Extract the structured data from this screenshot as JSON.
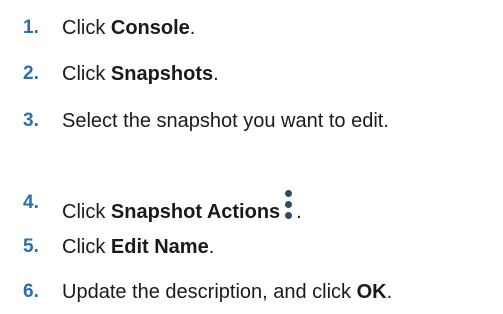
{
  "steps": [
    {
      "number": "1.",
      "before": "Click ",
      "bold": "Console",
      "after": "."
    },
    {
      "number": "2.",
      "before": "Click ",
      "bold": "Snapshots",
      "after": "."
    },
    {
      "number": "3.",
      "before": "Select the snapshot you want to edit.",
      "bold": "",
      "after": ""
    },
    {
      "number": "4.",
      "before": "Click ",
      "bold": "Snapshot Actions",
      "after": "."
    },
    {
      "number": "5.",
      "before": "Click ",
      "bold": "Edit Name",
      "after": "."
    },
    {
      "number": "6.",
      "before": "Update the description, and click ",
      "bold": "OK",
      "after": "."
    }
  ],
  "icons": {
    "snapshot_actions": "kebab-vertical-dots-icon"
  }
}
